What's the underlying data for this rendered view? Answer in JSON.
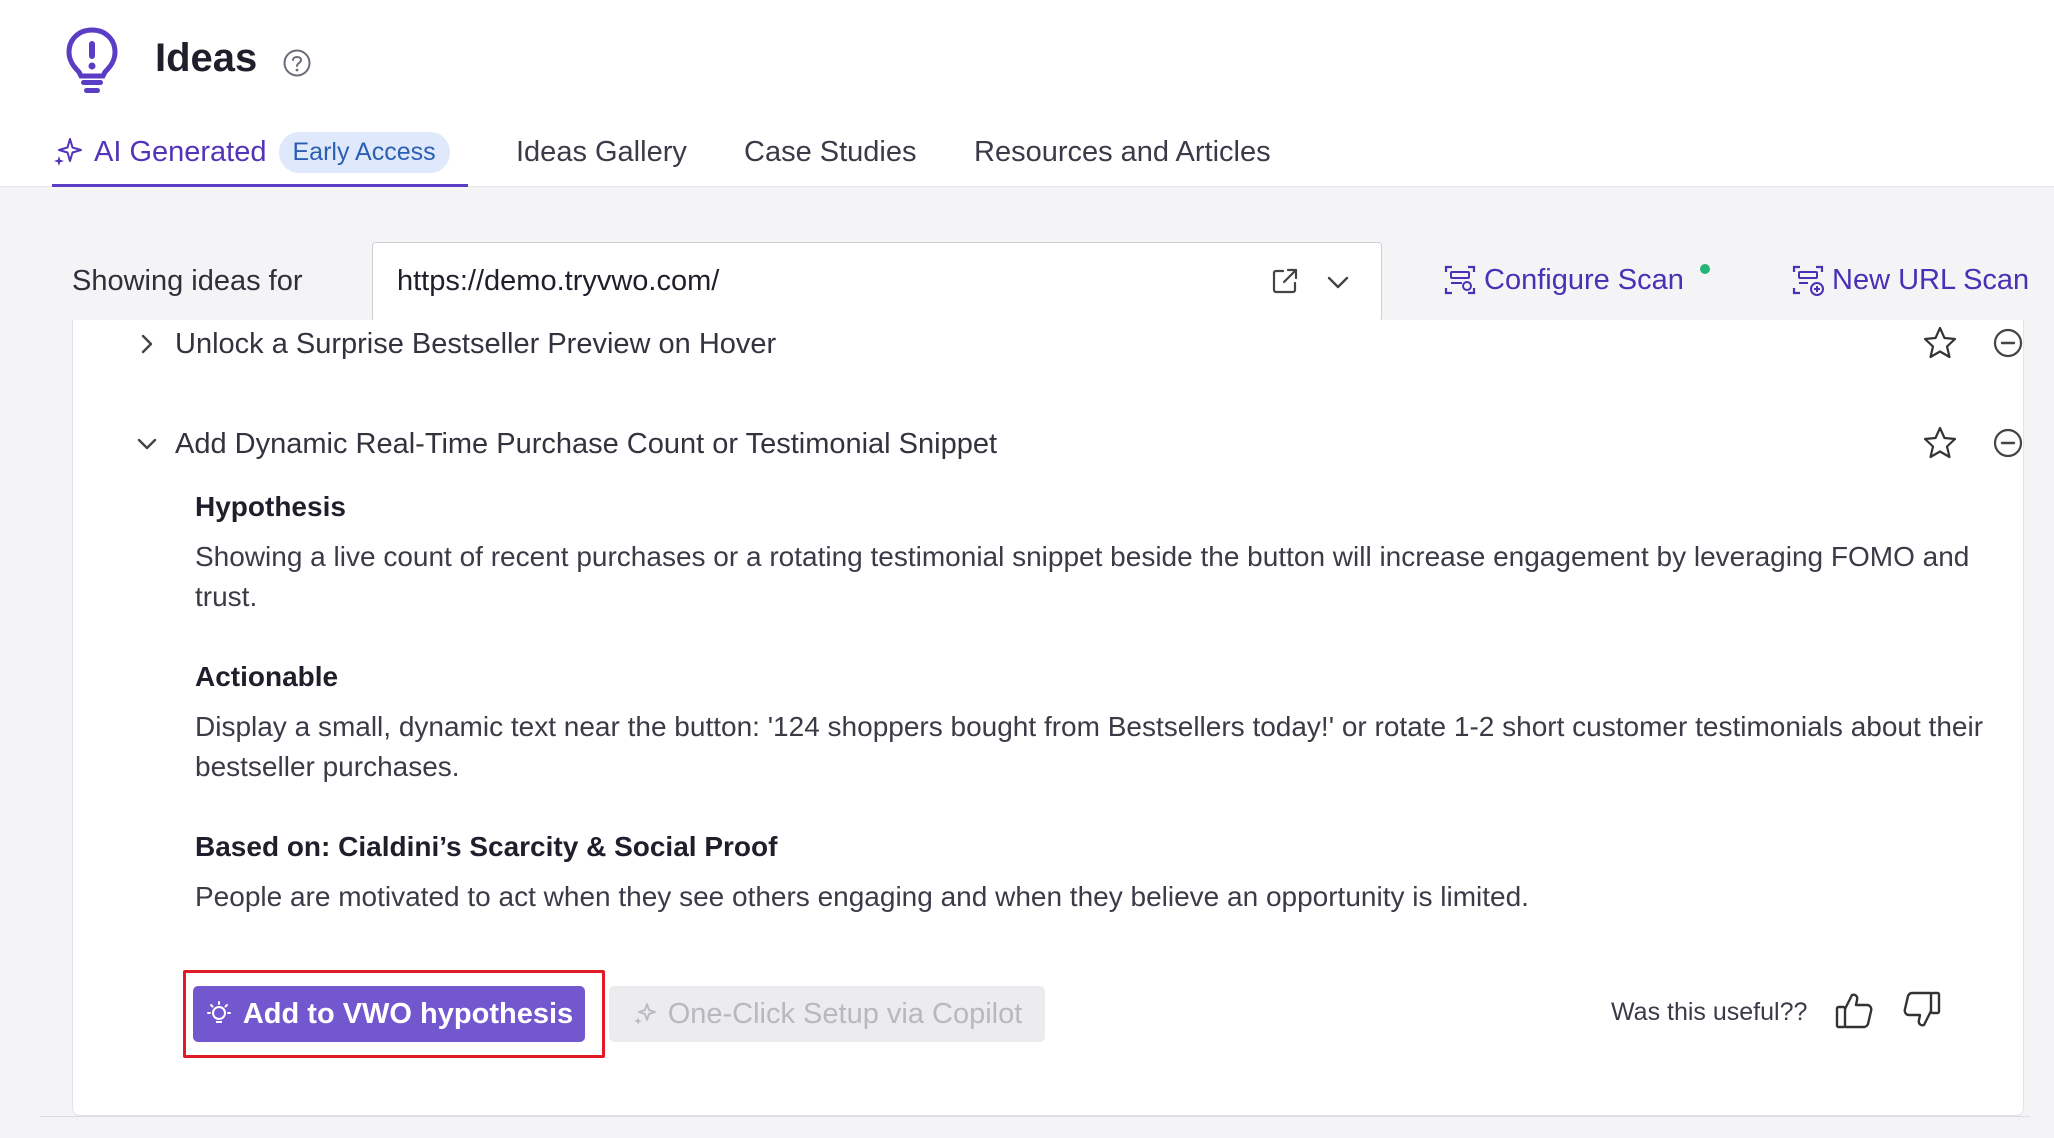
{
  "header": {
    "title": "Ideas",
    "tabs": [
      {
        "label": "AI Generated",
        "badge": "Early Access",
        "active": true
      },
      {
        "label": "Ideas Gallery"
      },
      {
        "label": "Case Studies"
      },
      {
        "label": "Resources and Articles"
      }
    ]
  },
  "filter": {
    "label": "Showing ideas for",
    "url": "https://demo.tryvwo.com/"
  },
  "actions": {
    "configure_scan": "Configure Scan",
    "new_url_scan": "New URL Scan"
  },
  "ideas": [
    {
      "title": "Unlock a Surprise Bestseller Preview on Hover",
      "expanded": false
    },
    {
      "title": "Add Dynamic Real-Time Purchase Count or Testimonial Snippet",
      "expanded": true,
      "hypothesis_heading": "Hypothesis",
      "hypothesis": "Showing a live count of recent purchases or a rotating testimonial snippet beside the button will increase engagement by leveraging FOMO and trust.",
      "actionable_heading": "Actionable",
      "actionable": "Display a small, dynamic text near the button: '124 shoppers bought from Bestsellers today!' or rotate 1-2 short customer testimonials about their bestseller purchases.",
      "based_on_heading": "Based on: Cialdini’s Scarcity & Social Proof",
      "based_on": "People are motivated to act when they see others engaging and when they believe an opportunity is limited."
    }
  ],
  "buttons": {
    "add_hypothesis": "Add to VWO hypothesis",
    "copilot_setup": "One-Click Setup via Copilot"
  },
  "feedback": {
    "question": "Was this useful??"
  },
  "colors": {
    "accent": "#5b3cc4",
    "primary_button": "#7357cf",
    "badge_bg": "#dfe9fb",
    "status_dot": "#22b573",
    "highlight": "#e01b24"
  },
  "icons": [
    "lightbulb-logo-icon",
    "help-icon",
    "sparkle-icon",
    "external-link-icon",
    "chevron-down-icon",
    "configure-scan-icon",
    "new-url-scan-icon",
    "chevron-right-icon",
    "star-icon",
    "minus-circle-icon",
    "bulb-icon",
    "thumbs-up-icon",
    "thumbs-down-icon"
  ]
}
